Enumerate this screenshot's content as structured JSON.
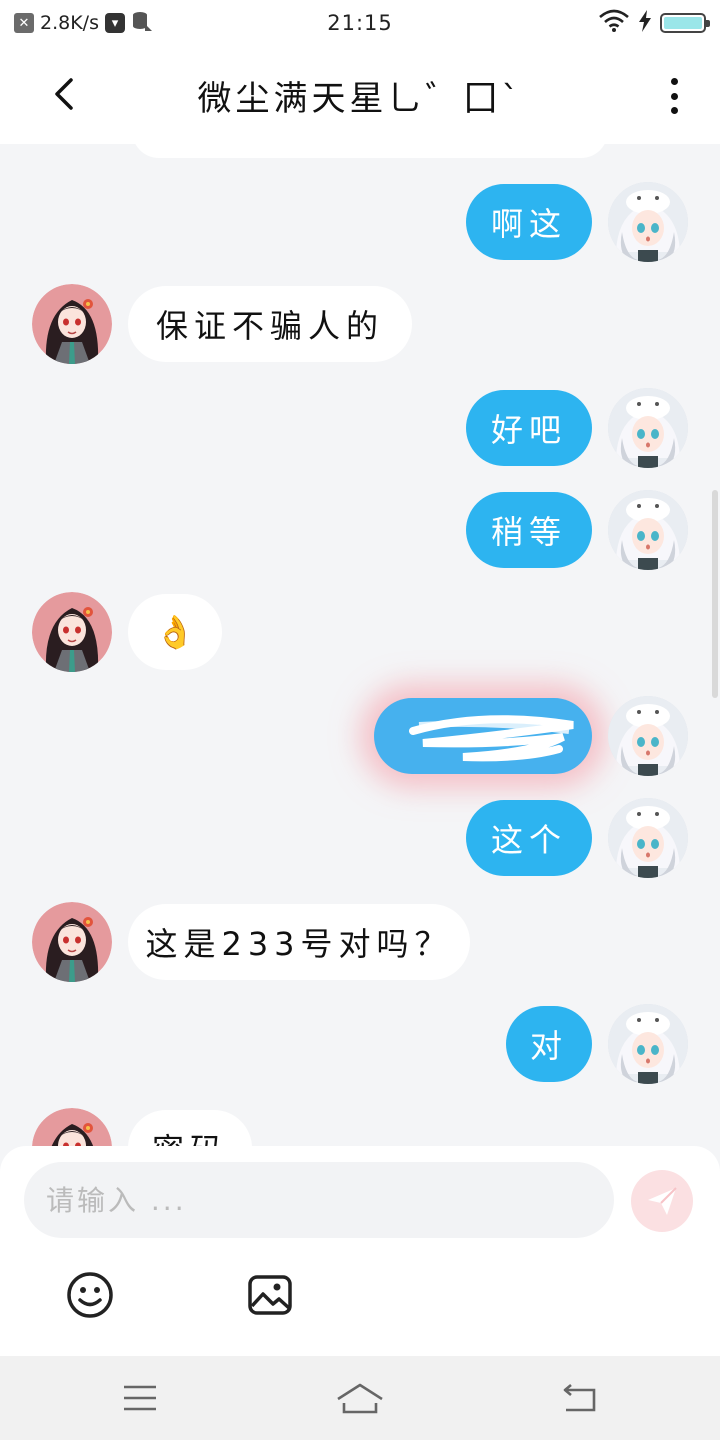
{
  "status_bar": {
    "network_speed": "2.8K/s",
    "time": "21:15",
    "battery_color": "#9ae6e9"
  },
  "header": {
    "title": "微尘满天星乚゛囗`",
    "back_icon": "chevron-left-icon",
    "more_icon": "more-vertical-icon"
  },
  "messages": [
    {
      "sender": "self",
      "text": "啊这"
    },
    {
      "sender": "other",
      "text": "保证不骗人的"
    },
    {
      "sender": "self",
      "text": "好吧"
    },
    {
      "sender": "self",
      "text": "稍等"
    },
    {
      "sender": "other",
      "text": "👌"
    },
    {
      "sender": "self",
      "text": "",
      "redacted": true
    },
    {
      "sender": "self",
      "text": "这个"
    },
    {
      "sender": "other",
      "text": "这是233号对吗？"
    },
    {
      "sender": "self",
      "text": "对"
    },
    {
      "sender": "other",
      "text": "密码"
    }
  ],
  "composer": {
    "placeholder": "请输入 ...",
    "value": "",
    "send_icon": "send-icon",
    "emoji_icon": "emoji-icon",
    "image_icon": "image-icon"
  },
  "nav_bar": {
    "menu_icon": "menu-icon",
    "home_icon": "home-icon",
    "back_icon": "back-icon"
  },
  "colors": {
    "self_bubble": "#2db4f0",
    "other_bubble": "#ffffff",
    "background": "#f4f5f7",
    "send_button": "#fbe0e2"
  }
}
